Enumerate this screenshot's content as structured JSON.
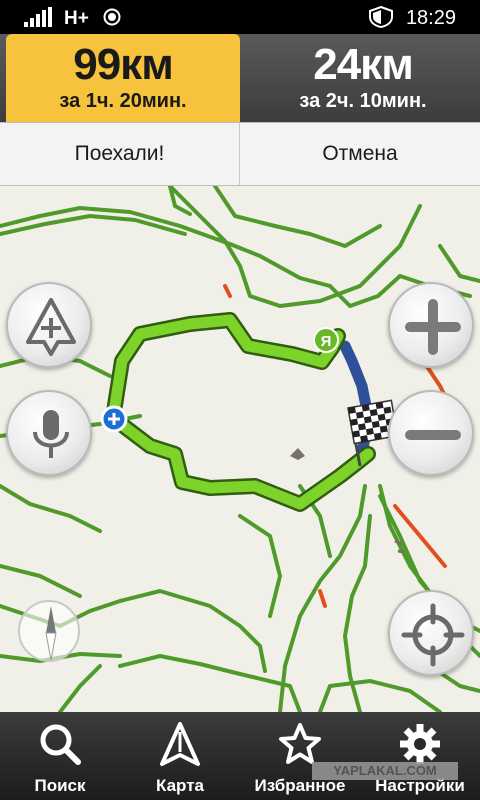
{
  "status_bar": {
    "network": "H+",
    "time": "18:29"
  },
  "routes": [
    {
      "distance": "99км",
      "duration": "за 1ч. 20мин.",
      "selected": true
    },
    {
      "distance": "24км",
      "duration": "за 2ч. 10мин.",
      "selected": false
    }
  ],
  "actions": {
    "go_label": "Поехали!",
    "cancel_label": "Отмена"
  },
  "map": {
    "icons": [
      "report-event-icon",
      "voice-icon",
      "zoom-in-icon",
      "zoom-out-icon",
      "locate-icon",
      "compass-icon",
      "start-marker-icon",
      "finish-flag-icon",
      "waypoint-icon"
    ],
    "start_marker_letter": "Я",
    "colors": {
      "route": "#7ed32a",
      "alt_route": "#2e4f9a",
      "traffic_free": "#4f9a2a",
      "traffic_jam": "#e0501e",
      "selected_route_tab": "#f7c23c"
    }
  },
  "nav": {
    "items": [
      {
        "label": "Поиск",
        "icon": "search-icon"
      },
      {
        "label": "Карта",
        "icon": "map-arrow-icon"
      },
      {
        "label": "Избранное",
        "icon": "star-icon"
      },
      {
        "label": "Настройки",
        "icon": "gear-icon"
      }
    ],
    "watermark": "YAPLAKAL.COM"
  }
}
